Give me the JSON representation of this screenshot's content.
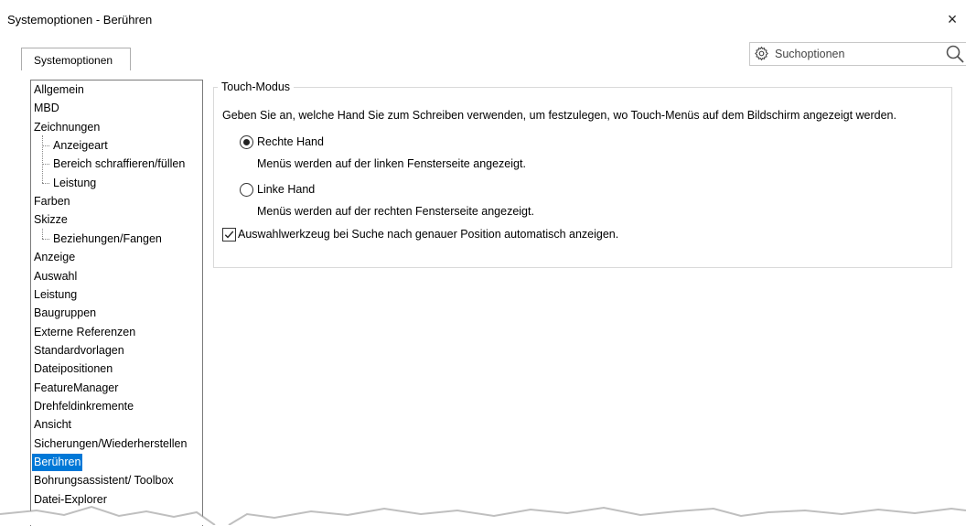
{
  "window": {
    "title": "Systemoptionen - Berühren",
    "close_label": "×"
  },
  "tabs": [
    {
      "label": "Systemoptionen",
      "active": true
    }
  ],
  "search": {
    "placeholder": "Suchoptionen",
    "gear_icon": "gear-icon",
    "magnifier_icon": "search-icon"
  },
  "tree": {
    "items": [
      {
        "label": "Allgemein",
        "level": 0
      },
      {
        "label": "MBD",
        "level": 0
      },
      {
        "label": "Zeichnungen",
        "level": 0
      },
      {
        "label": "Anzeigeart",
        "level": 1
      },
      {
        "label": "Bereich schraffieren/füllen",
        "level": 1
      },
      {
        "label": "Leistung",
        "level": 1
      },
      {
        "label": "Farben",
        "level": 0
      },
      {
        "label": "Skizze",
        "level": 0
      },
      {
        "label": "Beziehungen/Fangen",
        "level": 1
      },
      {
        "label": "Anzeige",
        "level": 0
      },
      {
        "label": "Auswahl",
        "level": 0
      },
      {
        "label": "Leistung",
        "level": 0
      },
      {
        "label": "Baugruppen",
        "level": 0
      },
      {
        "label": "Externe Referenzen",
        "level": 0
      },
      {
        "label": "Standardvorlagen",
        "level": 0
      },
      {
        "label": "Dateipositionen",
        "level": 0
      },
      {
        "label": "FeatureManager",
        "level": 0
      },
      {
        "label": "Drehfeldinkremente",
        "level": 0
      },
      {
        "label": "Ansicht",
        "level": 0
      },
      {
        "label": "Sicherungen/Wiederherstellen",
        "level": 0
      },
      {
        "label": "Berühren",
        "level": 0,
        "selected": true
      },
      {
        "label": "Bohrungsassistent/ Toolbox",
        "level": 0
      },
      {
        "label": "Datei-Explorer",
        "level": 0
      }
    ]
  },
  "touch_mode": {
    "legend": "Touch-Modus",
    "description": "Geben Sie an, welche Hand Sie zum Schreiben verwenden, um festzulegen, wo Touch-Menüs auf dem Bildschirm angezeigt werden.",
    "right_hand": {
      "label": "Rechte Hand",
      "hint": "Menüs werden auf der linken Fensterseite angezeigt.",
      "selected": true
    },
    "left_hand": {
      "label": "Linke Hand",
      "hint": "Menüs werden auf der rechten Fensterseite angezeigt.",
      "selected": false
    },
    "auto_show": {
      "label": "Auswahlwerkzeug bei Suche nach genauer Position automatisch anzeigen.",
      "checked": true
    }
  },
  "colors": {
    "selection": "#0078d7",
    "border": "#adadad"
  }
}
